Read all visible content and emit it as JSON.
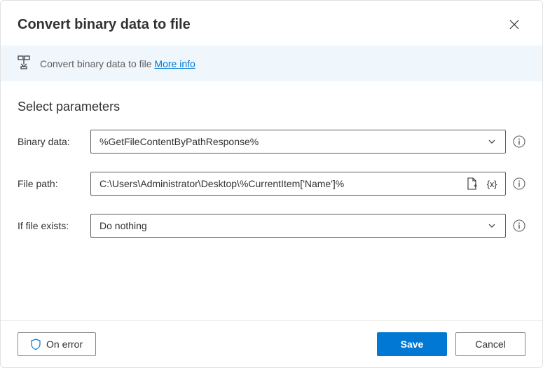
{
  "header": {
    "title": "Convert binary data to file"
  },
  "infoBar": {
    "text": "Convert binary data to file",
    "link": "More info"
  },
  "section": {
    "title": "Select parameters"
  },
  "fields": {
    "binaryData": {
      "label": "Binary data:",
      "value": "%GetFileContentByPathResponse%"
    },
    "filePath": {
      "label": "File path:",
      "value": "C:\\Users\\Administrator\\Desktop\\%CurrentItem['Name']%"
    },
    "ifFileExists": {
      "label": "If file exists:",
      "value": "Do nothing"
    }
  },
  "footer": {
    "onError": "On error",
    "save": "Save",
    "cancel": "Cancel"
  },
  "variableGlyph": "{x}"
}
